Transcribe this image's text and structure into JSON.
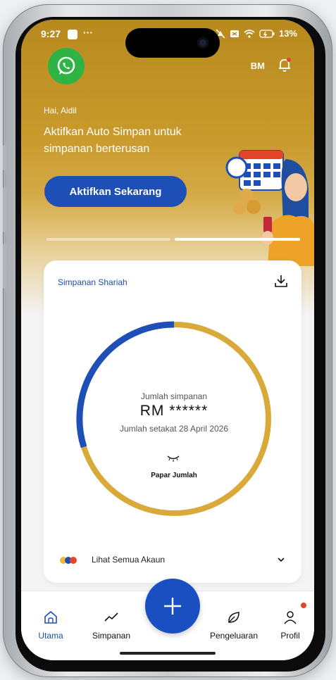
{
  "status_bar": {
    "time": "9:27",
    "overflow": "···",
    "battery_label": "13%"
  },
  "header": {
    "initials": "BM"
  },
  "hero": {
    "greeting": "Hai, Aidil",
    "headline": "Aktifkan Auto Simpan untuk simpanan berterusan",
    "cta_label": "Aktifkan Sekarang"
  },
  "carousel": {
    "pages": 2,
    "active_page": 2
  },
  "savings_card": {
    "title": "Simpanan Shariah",
    "amount_label": "Jumlah simpanan",
    "amount": "RM ******",
    "as_of": "Jumlah setakat 28 April 2026",
    "show_label": "Papar Jumlah",
    "all_accounts": "Lihat Semua Akaun",
    "ring_colors": {
      "blue": "#1d4fb6",
      "gold": "#d9a93a"
    }
  },
  "nav": {
    "items": [
      {
        "label": "Utama",
        "icon": "home-icon",
        "active": true
      },
      {
        "label": "Simpanan",
        "icon": "trend-icon",
        "active": false
      },
      {
        "label": "Pengeluaran",
        "icon": "leaf-icon",
        "active": false
      },
      {
        "label": "Profil",
        "icon": "user-icon",
        "active": false
      }
    ],
    "fab_icon": "plus-icon"
  },
  "colors": {
    "brand_blue": "#1d4fb6",
    "hero_gold": "#c99a2c",
    "whatsapp_green": "#2fb344"
  }
}
